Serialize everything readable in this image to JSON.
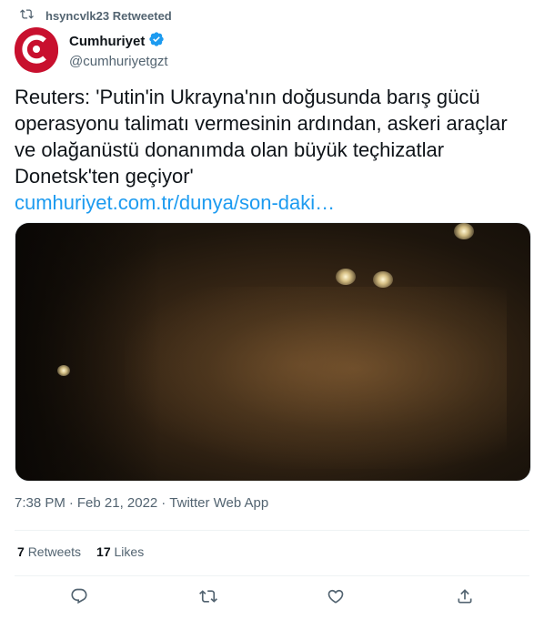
{
  "retweet": {
    "label": "hsyncvlk23 Retweeted",
    "icon": "retweet-icon"
  },
  "author": {
    "display_name": "Cumhuriyet",
    "handle": "@cumhuriyetgzt",
    "verified_icon": "verified-badge-icon",
    "avatar_icon": "cumhuriyet-logo-icon"
  },
  "tweet": {
    "text": "Reuters: 'Putin'in Ukrayna'nın doğusunda barış gücü operasyonu talimatı vermesinin ardından, askeri araçlar ve olağanüstü donanımda olan büyük teçhizatlar Donetsk'ten geçiyor'",
    "link": "cumhuriyet.com.tr/dunya/son-daki…"
  },
  "meta": {
    "time": "7:38 PM",
    "date": "Feb 21, 2022",
    "source": "Twitter Web App",
    "separator": "·"
  },
  "stats": {
    "retweets_count": "7",
    "retweets_label": "Retweets",
    "likes_count": "17",
    "likes_label": "Likes"
  },
  "actions": [
    "reply-icon",
    "retweet-icon",
    "like-icon",
    "share-icon"
  ],
  "colors": {
    "link": "#1d9bf0",
    "secondary_text": "#536471",
    "brand_red": "#c8102e",
    "verified": "#1d9bf0"
  }
}
